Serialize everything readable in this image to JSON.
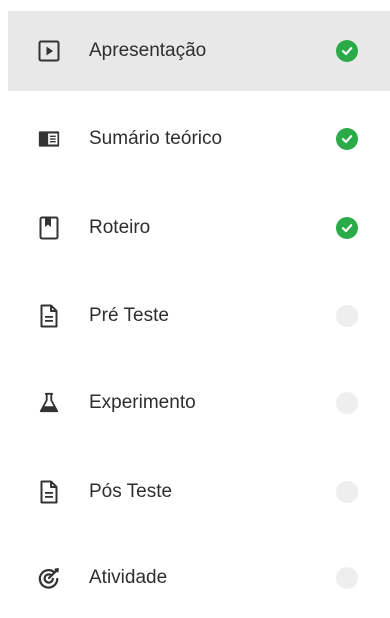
{
  "colors": {
    "done": "#2bab47",
    "pending": "#eeeeee",
    "active_background": "#e8e8e8",
    "text": "#2e2e2e"
  },
  "items": [
    {
      "label": "Apresentação",
      "icon": "play-square-icon",
      "completed": true,
      "active": true
    },
    {
      "label": "Sumário teórico",
      "icon": "book-summary-icon",
      "completed": true,
      "active": false
    },
    {
      "label": "Roteiro",
      "icon": "bookmark-page-icon",
      "completed": true,
      "active": false
    },
    {
      "label": "Pré Teste",
      "icon": "document-icon",
      "completed": false,
      "active": false
    },
    {
      "label": "Experimento",
      "icon": "flask-icon",
      "completed": false,
      "active": false
    },
    {
      "label": "Pós Teste",
      "icon": "document-icon",
      "completed": false,
      "active": false
    },
    {
      "label": "Atividade",
      "icon": "target-icon",
      "completed": false,
      "active": false
    }
  ]
}
